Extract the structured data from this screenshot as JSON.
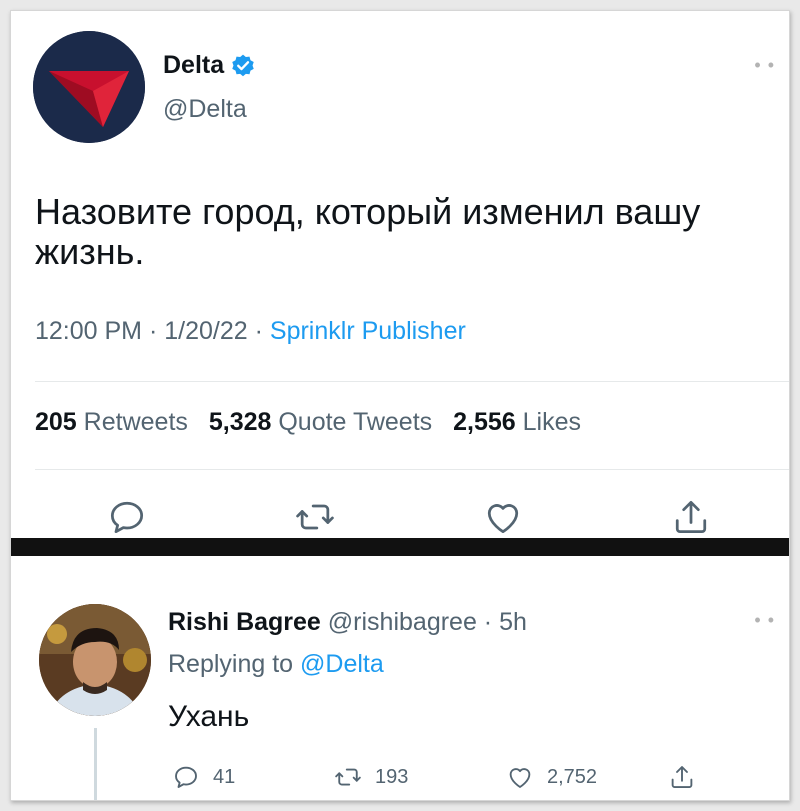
{
  "tweet": {
    "author_name": "Delta",
    "author_handle": "@Delta",
    "text": "Назовите город, который изменил вашу жизнь.",
    "time": "12:00 PM",
    "date": "1/20/22",
    "source": "Sprinklr Publisher",
    "stats": {
      "retweets_count": "205",
      "retweets_label": "Retweets",
      "quotes_count": "5,328",
      "quotes_label": "Quote Tweets",
      "likes_count": "2,556",
      "likes_label": "Likes"
    },
    "actions": [
      "reply-icon",
      "retweet-icon",
      "like-icon",
      "share-icon"
    ]
  },
  "reply": {
    "author_name": "Rishi Bagree",
    "author_handle": "@rishibagree",
    "time": "5h",
    "replying_prefix": "Replying to",
    "replying_to": "@Delta",
    "text": "Ухань",
    "counts": {
      "replies": "41",
      "retweets": "193",
      "likes": "2,752"
    }
  },
  "colors": {
    "accent": "#1d9bf0",
    "secondary_text": "#536471",
    "primary_text": "#0f1419",
    "delta_red": "#c8102e",
    "delta_navy": "#1b2a4a"
  }
}
